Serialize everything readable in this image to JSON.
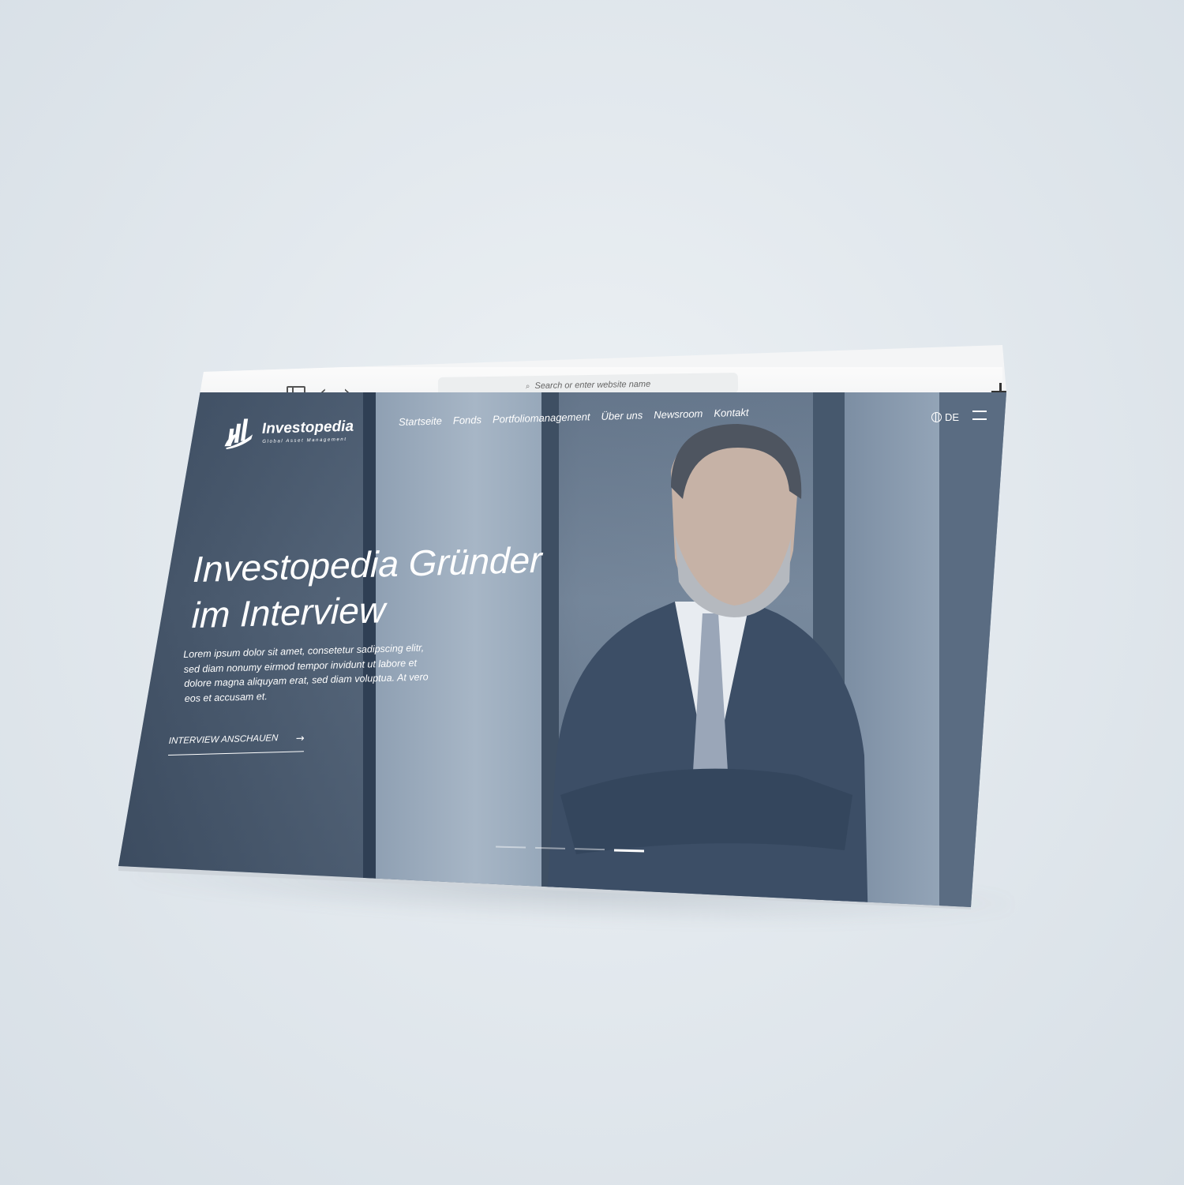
{
  "browser": {
    "url_placeholder": "Search or enter website name"
  },
  "site": {
    "logo": {
      "name": "Investopedia",
      "tagline": "Global Asset Management"
    },
    "nav": [
      {
        "label": "Startseite"
      },
      {
        "label": "Fonds"
      },
      {
        "label": "Portfoliomanagement"
      },
      {
        "label": "Über uns"
      },
      {
        "label": "Newsroom"
      },
      {
        "label": "Kontakt"
      }
    ],
    "language": "DE",
    "hero": {
      "title_line1": "Investopedia Gründer",
      "title_line2": "im Interview",
      "body": "Lorem ipsum dolor sit amet, consetetur sadipscing elitr, sed diam nonumy eirmod tempor invidunt ut labore et dolore magna aliquyam erat, sed diam voluptua. At vero eos et accusam et.",
      "cta_label": "INTERVIEW ANSCHAUEN"
    },
    "slider": {
      "total": 4,
      "active": 4
    }
  },
  "colors": {
    "background": "#e3e9ee",
    "hero_overlay": "#4a5c72",
    "traffic_red": "#f2453b",
    "traffic_yellow": "#f39a2b",
    "traffic_green": "#35c63a",
    "text_on_hero": "#ffffff"
  },
  "icons": [
    "sidebar-icon",
    "back-icon",
    "forward-icon",
    "search-icon",
    "plus-icon",
    "tabs-icon",
    "logo-icon",
    "globe-icon",
    "menu-icon",
    "arrow-right-icon"
  ]
}
